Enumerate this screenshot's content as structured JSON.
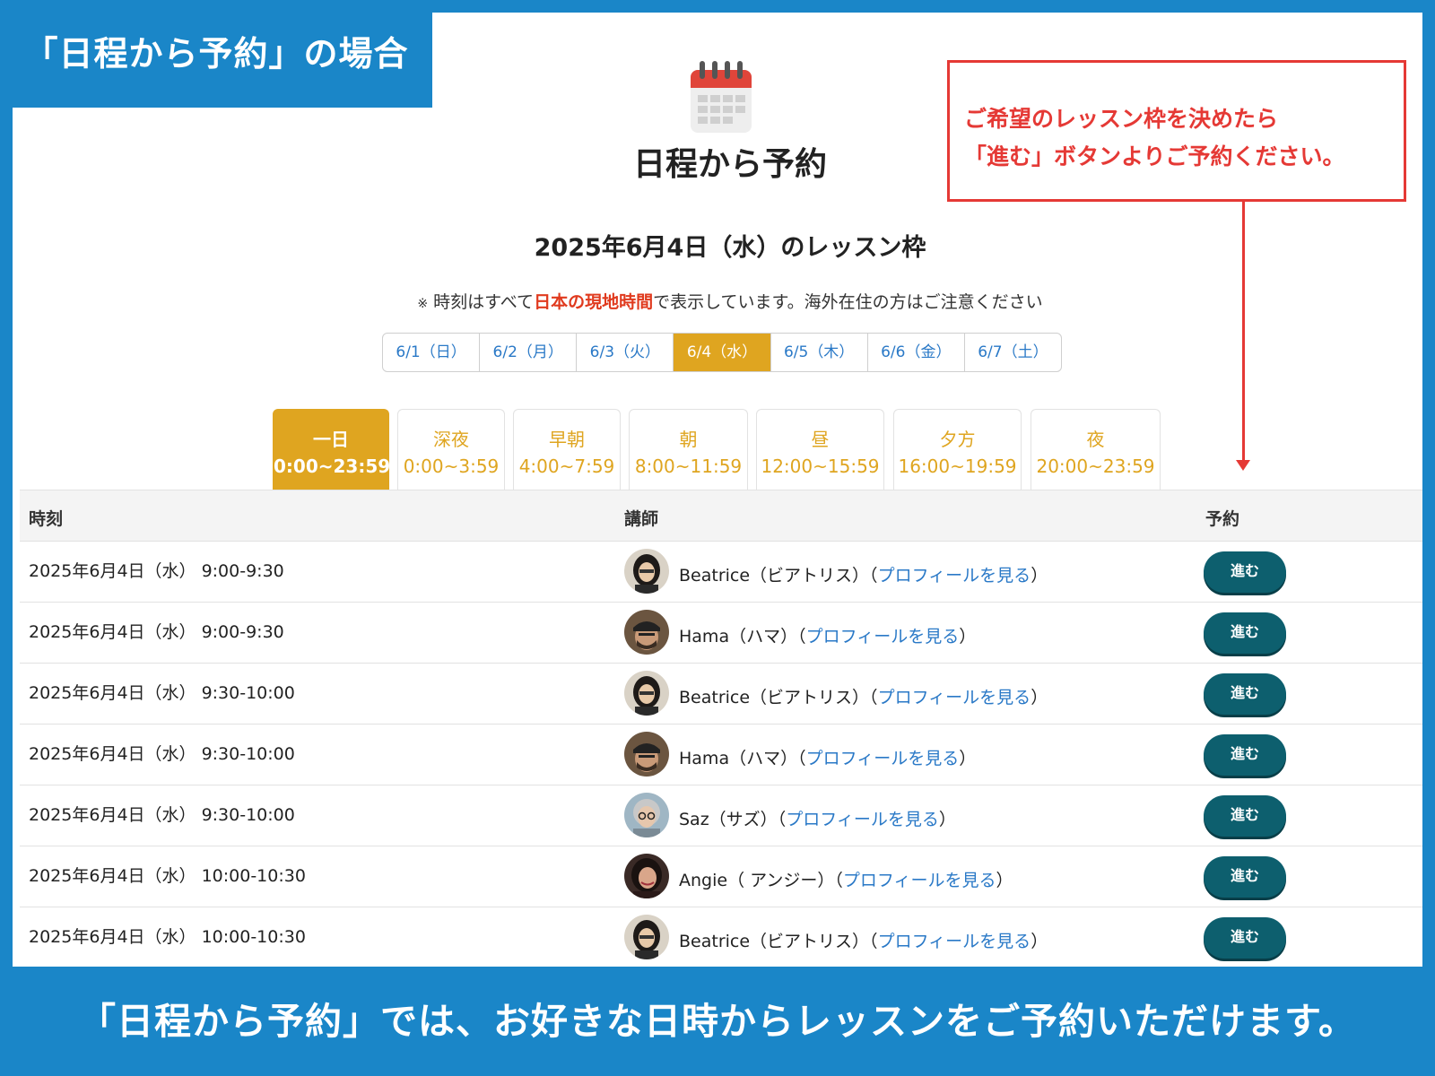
{
  "corner_label": "「日程から予約」の場合",
  "bottom_caption": "「日程から予約」では、お好きな日時からレッスンをご予約いただけます。",
  "header": {
    "icon": "calendar-icon",
    "title": "日程から予約",
    "subtitle": "2025年6月4日（水）のレッスン枠",
    "notice_mark": "※",
    "notice_before": "時刻はすべて",
    "notice_highlight": "日本の現地時間",
    "notice_after": "で表示しています。海外在住の方はご注意ください"
  },
  "callout": {
    "line1": "ご希望のレッスン枠を決めたら",
    "line2": "「進む」ボタンよりご予約ください。"
  },
  "date_tabs": [
    {
      "label": "6/1（日）"
    },
    {
      "label": "6/2（月）"
    },
    {
      "label": "6/3（火）"
    },
    {
      "label": "6/4（水）"
    },
    {
      "label": "6/5（木）"
    },
    {
      "label": "6/6（金）"
    },
    {
      "label": "6/7（土）"
    }
  ],
  "time_tabs": [
    {
      "name": "一日",
      "range": "0:00~23:59"
    },
    {
      "name": "深夜",
      "range": "0:00~3:59"
    },
    {
      "name": "早朝",
      "range": "4:00~7:59"
    },
    {
      "name": "朝",
      "range": "8:00~11:59"
    },
    {
      "name": "昼",
      "range": "12:00~15:59"
    },
    {
      "name": "夕方",
      "range": "16:00~19:59"
    },
    {
      "name": "夜",
      "range": "20:00~23:59"
    }
  ],
  "table": {
    "headers": {
      "time": "時刻",
      "teacher": "講師",
      "reserve": "予約"
    },
    "profile_link": "プロフィールを見る",
    "button_label": "進む",
    "rows": [
      {
        "time": "2025年6月4日（水） 9:00-9:30",
        "teacher": "Beatrice（ビアトリス）"
      },
      {
        "time": "2025年6月4日（水） 9:00-9:30",
        "teacher": "Hama（ハマ）"
      },
      {
        "time": "2025年6月4日（水） 9:30-10:00",
        "teacher": "Beatrice（ビアトリス）"
      },
      {
        "time": "2025年6月4日（水） 9:30-10:00",
        "teacher": "Hama（ハマ）"
      },
      {
        "time": "2025年6月4日（水） 9:30-10:00",
        "teacher": "Saz（サズ）"
      },
      {
        "time": "2025年6月4日（水） 10:00-10:30",
        "teacher": "Angie（ アンジー）"
      },
      {
        "time": "2025年6月4日（水） 10:00-10:30",
        "teacher": "Beatrice（ビアトリス）"
      }
    ]
  },
  "colors": {
    "brand_blue": "#1a86c8",
    "accent_gold": "#dfa520",
    "button_teal": "#0d5f6e",
    "callout_red": "#e53935",
    "link_blue": "#2a79c7"
  }
}
